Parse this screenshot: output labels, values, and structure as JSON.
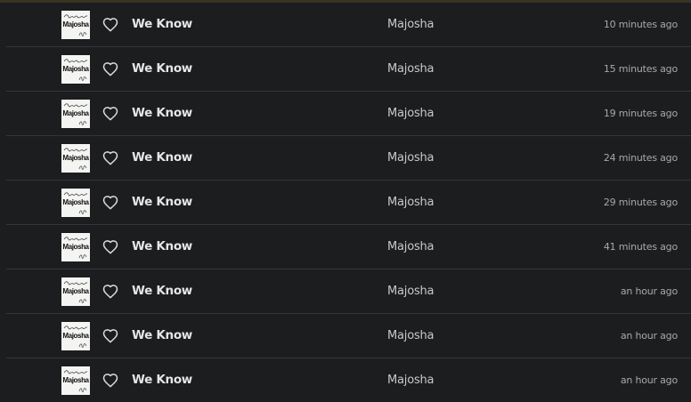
{
  "colors": {
    "background": "#1c1d1f",
    "divider": "#34363a",
    "title": "#e6e6e6",
    "artist": "#c9c9c9",
    "time": "#a9a9a9"
  },
  "cover_logo_text": "Majosha",
  "tracks": [
    {
      "title": "We Know",
      "artist": "Majosha",
      "played": "10 minutes ago",
      "icon": "heart-outline-icon"
    },
    {
      "title": "We Know",
      "artist": "Majosha",
      "played": "15 minutes ago",
      "icon": "heart-outline-icon"
    },
    {
      "title": "We Know",
      "artist": "Majosha",
      "played": "19 minutes ago",
      "icon": "heart-outline-icon"
    },
    {
      "title": "We Know",
      "artist": "Majosha",
      "played": "24 minutes ago",
      "icon": "heart-outline-icon"
    },
    {
      "title": "We Know",
      "artist": "Majosha",
      "played": "29 minutes ago",
      "icon": "heart-outline-icon"
    },
    {
      "title": "We Know",
      "artist": "Majosha",
      "played": "41 minutes ago",
      "icon": "heart-outline-icon"
    },
    {
      "title": "We Know",
      "artist": "Majosha",
      "played": "an hour ago",
      "icon": "heart-outline-icon"
    },
    {
      "title": "We Know",
      "artist": "Majosha",
      "played": "an hour ago",
      "icon": "heart-outline-icon"
    },
    {
      "title": "We Know",
      "artist": "Majosha",
      "played": "an hour ago",
      "icon": "heart-outline-icon"
    }
  ]
}
